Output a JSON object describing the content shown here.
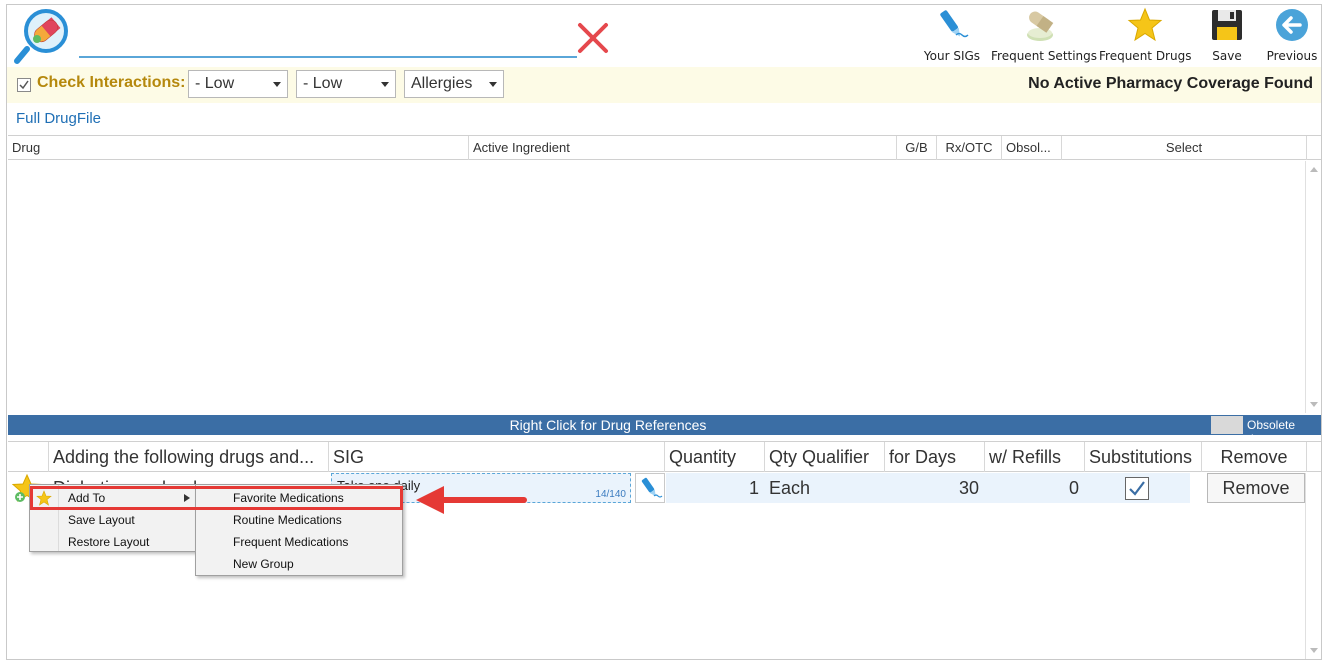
{
  "toolbar": {
    "your_sigs": "Your SIGs",
    "frequent_settings": "Frequent Settings",
    "frequent_drugs": "Frequent Drugs",
    "save": "Save",
    "previous": "Previous",
    "icons": [
      "search-pill-icon",
      "clear-x-icon",
      "pen-icon",
      "pills-icon",
      "star-icon",
      "floppy-disk-icon",
      "back-arrow-icon"
    ]
  },
  "filters": {
    "check_interactions_label": "Check Interactions:",
    "check_interactions_checked": true,
    "severity1": "- Low",
    "severity2": "- Low",
    "allergies": "Allergies",
    "coverage_status": "No Active Pharmacy Coverage Found"
  },
  "drugfile": {
    "title": "Full DrugFile",
    "columns": [
      "Drug",
      "Active Ingredient",
      "G/B",
      "Rx/OTC",
      "Obsol...",
      "Select"
    ]
  },
  "status_bar": {
    "message": "Right Click for Drug References",
    "obsolete_label": "Obsolete drug",
    "obsolete_color": "#d9d9d9",
    "bar_color": "#3b6ea5"
  },
  "selected": {
    "columns": [
      "Adding the following drugs and...",
      "SIG",
      "Quantity",
      "Qty Qualifier",
      "for Days",
      "w/ Refills",
      "Substitutions",
      "Remove"
    ],
    "row": {
      "drug": "Diabetic wonder drug",
      "sig": "Take one daily",
      "sig_count": "14/140",
      "quantity": "1",
      "qty_qualifier": "Each",
      "days": "30",
      "refills": "0",
      "substitutions": true,
      "remove": "Remove"
    }
  },
  "context_menu": {
    "items": [
      "Add To",
      "Save Layout",
      "Restore Layout"
    ],
    "submenu": [
      "Favorite Medications",
      "Routine Medications",
      "Frequent Medications",
      "New Group"
    ]
  },
  "colors": {
    "accent": "#5aa6d8",
    "highlight": "#e53935",
    "link": "#1f6fb5",
    "label_gold": "#b5880d"
  }
}
